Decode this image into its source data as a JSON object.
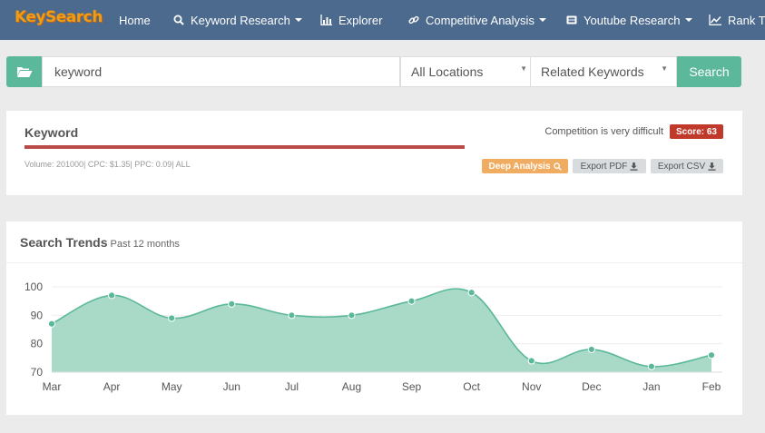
{
  "nav": {
    "logo": "KeySearch",
    "items": [
      {
        "label": "Home",
        "icon": "",
        "caret": false
      },
      {
        "label": "Keyword Research",
        "icon": "search-icon",
        "caret": true
      },
      {
        "label": "Explorer",
        "icon": "bar-chart-icon",
        "caret": false
      },
      {
        "label": "Competitive Analysis",
        "icon": "link-icon",
        "caret": true
      },
      {
        "label": "Youtube Research",
        "icon": "video-icon",
        "caret": true
      },
      {
        "label": "Rank Tr",
        "icon": "line-chart-icon",
        "caret": false
      }
    ]
  },
  "search": {
    "keyword_value": "keyword",
    "location": "All Locations",
    "mode": "Related Keywords",
    "button": "Search"
  },
  "keyword_panel": {
    "title": "Keyword",
    "meta": "Volume: 201000| CPC: $1.35| PPC: 0.09| ALL",
    "competition": "Competition is very difficult",
    "score": "Score: 63",
    "deep_analysis": "Deep Analysis",
    "export_pdf": "Export PDF",
    "export_csv": "Export CSV",
    "score_color": "#c0392b"
  },
  "trends": {
    "title": "Search Trends",
    "subtitle": "Past 12 months"
  },
  "chart_data": {
    "type": "area",
    "categories": [
      "Mar",
      "Apr",
      "May",
      "Jun",
      "Jul",
      "Aug",
      "Sep",
      "Oct",
      "Nov",
      "Dec",
      "Jan",
      "Feb"
    ],
    "values": [
      87,
      97,
      89,
      94,
      90,
      90,
      95,
      98,
      74,
      78,
      72,
      76
    ],
    "yticks": [
      70,
      80,
      90,
      100
    ],
    "ylim": [
      70,
      100
    ],
    "color": "#5cb89a",
    "fill": "#9fd6c1"
  }
}
